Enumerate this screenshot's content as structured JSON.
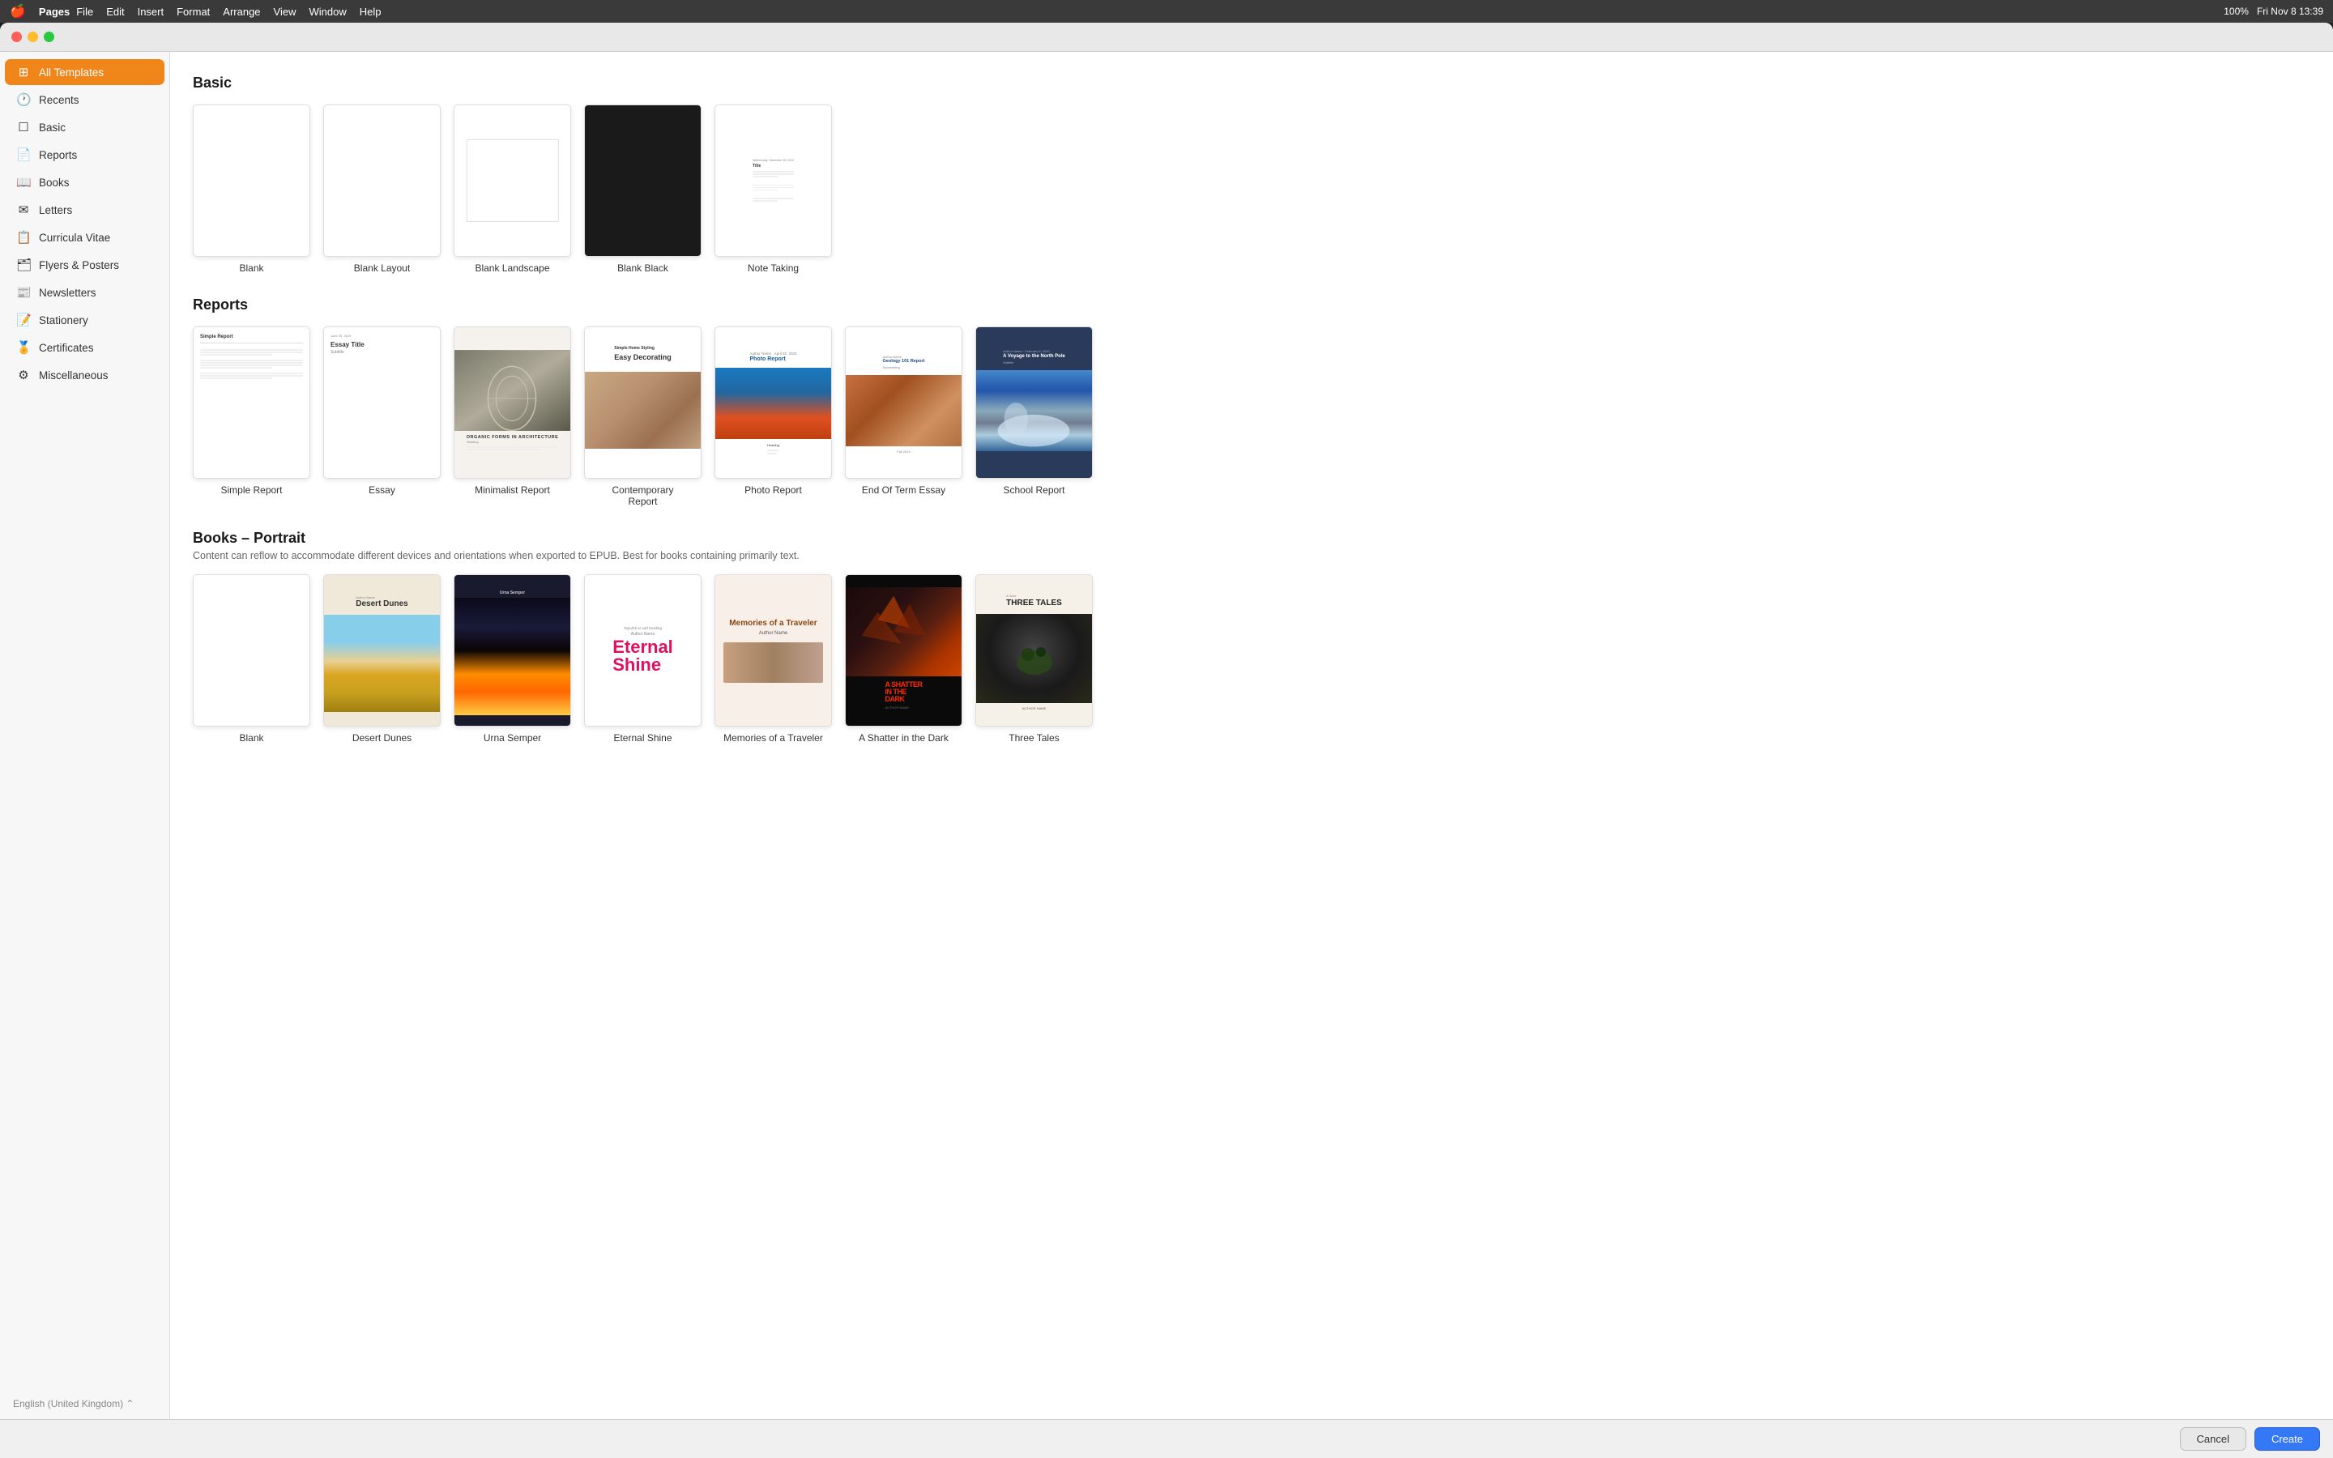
{
  "menubar": {
    "apple": "🍎",
    "app": "Pages",
    "items": [
      "File",
      "Edit",
      "Insert",
      "Format",
      "Arrange",
      "View",
      "Window",
      "Help"
    ],
    "right": {
      "battery": "100%",
      "datetime": "Fri Nov 8  13:39"
    }
  },
  "traffic_lights": {
    "red": "close",
    "yellow": "minimize",
    "green": "maximize"
  },
  "sidebar": {
    "items": [
      {
        "id": "all-templates",
        "label": "All Templates",
        "icon": "⊞",
        "active": true
      },
      {
        "id": "recents",
        "label": "Recents",
        "icon": "🕐"
      },
      {
        "id": "basic",
        "label": "Basic",
        "icon": "☐"
      },
      {
        "id": "reports",
        "label": "Reports",
        "icon": "📄"
      },
      {
        "id": "books",
        "label": "Books",
        "icon": "📖"
      },
      {
        "id": "letters",
        "label": "Letters",
        "icon": "✉"
      },
      {
        "id": "curricula-vitae",
        "label": "Curricula Vitae",
        "icon": "📋"
      },
      {
        "id": "flyers-posters",
        "label": "Flyers & Posters",
        "icon": "🗂"
      },
      {
        "id": "newsletters",
        "label": "Newsletters",
        "icon": "📰"
      },
      {
        "id": "stationery",
        "label": "Stationery",
        "icon": "📝"
      },
      {
        "id": "certificates",
        "label": "Certificates",
        "icon": "🏅"
      },
      {
        "id": "miscellaneous",
        "label": "Miscellaneous",
        "icon": "⚙"
      }
    ],
    "language": "English (United Kingdom)"
  },
  "sections": {
    "basic": {
      "title": "Basic",
      "templates": [
        {
          "id": "blank",
          "label": "Blank"
        },
        {
          "id": "blank-layout",
          "label": "Blank Layout"
        },
        {
          "id": "blank-landscape",
          "label": "Blank Landscape"
        },
        {
          "id": "blank-black",
          "label": "Blank Black"
        },
        {
          "id": "note-taking",
          "label": "Note Taking"
        }
      ]
    },
    "reports": {
      "title": "Reports",
      "templates": [
        {
          "id": "simple-report",
          "label": "Simple Report"
        },
        {
          "id": "essay",
          "label": "Essay"
        },
        {
          "id": "minimalist-report",
          "label": "Minimalist Report"
        },
        {
          "id": "contemporary-report",
          "label": "Contemporary Report"
        },
        {
          "id": "photo-report",
          "label": "Photo Report"
        },
        {
          "id": "end-of-term-essay",
          "label": "End Of Term Essay"
        },
        {
          "id": "school-report",
          "label": "School Report"
        }
      ]
    },
    "books": {
      "title": "Books – Portrait",
      "subtitle": "Content can reflow to accommodate different devices and orientations when exported to EPUB. Best for books containing primarily text.",
      "templates": [
        {
          "id": "book-blank",
          "label": "Blank"
        },
        {
          "id": "desert-dunes",
          "label": "Desert Dunes"
        },
        {
          "id": "urna-semper",
          "label": "Urna Semper"
        },
        {
          "id": "eternal-shine",
          "label": "Eternal Shine"
        },
        {
          "id": "memories-traveler",
          "label": "Memories of a Traveler"
        },
        {
          "id": "shatter-dark",
          "label": "A Shatter in the Dark"
        },
        {
          "id": "three-tales",
          "label": "Three Tales"
        }
      ]
    }
  },
  "footer": {
    "cancel": "Cancel",
    "create": "Create"
  }
}
